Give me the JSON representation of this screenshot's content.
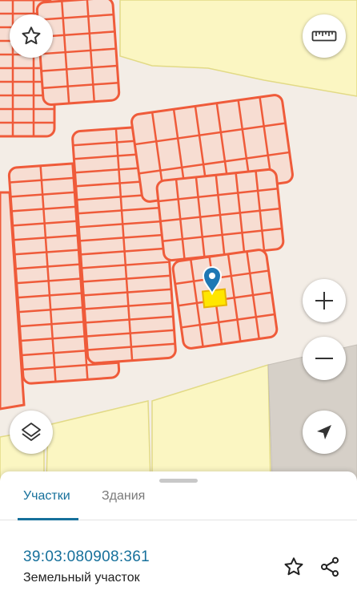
{
  "map": {
    "colors": {
      "background": "#f3ede6",
      "field": "#fbf6c2",
      "field_border": "#e2da86",
      "road": "#d6d0c8",
      "parcel_fill": "#f7ddd2",
      "parcel_stroke": "#ef5b3a",
      "selected_fill": "#ffe600",
      "pin": "#1f78b4"
    }
  },
  "controls": {
    "favorite": {
      "icon": "star-outline-icon"
    },
    "ruler": {
      "icon": "ruler-icon"
    },
    "zoom_in": {
      "icon": "plus-icon"
    },
    "zoom_out": {
      "icon": "minus-icon"
    },
    "layers": {
      "icon": "layers-icon"
    },
    "locate": {
      "icon": "navigation-arrow-icon"
    }
  },
  "sheet": {
    "tabs": [
      {
        "label": "Участки",
        "active": true
      },
      {
        "label": "Здания",
        "active": false
      }
    ],
    "parcel": {
      "number": "39:03:080908:361",
      "type": "Земельный участок"
    },
    "accent": "#16709b"
  }
}
